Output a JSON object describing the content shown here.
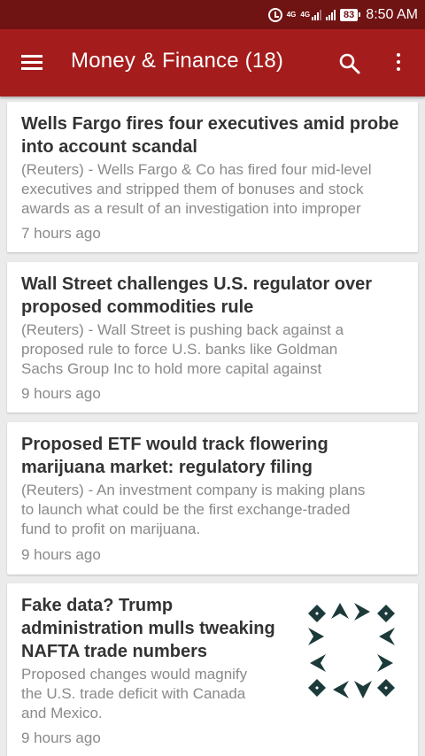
{
  "status_bar": {
    "network_label": "4G",
    "network_label_2": "4G",
    "battery": "83",
    "time": "8:50 AM"
  },
  "app_bar": {
    "title": "Money & Finance (18)",
    "menu_icon": "hamburger-menu-icon",
    "search_icon": "search-icon",
    "more_icon": "overflow-menu-icon",
    "color": "#a51c1c",
    "status_color": "#6f1313"
  },
  "articles": [
    {
      "title_lines": [
        "Wells Fargo fires four executives amid probe",
        "into account scandal"
      ],
      "summary_lines": [
        "(Reuters) - Wells Fargo & Co has fired four mid-level",
        "executives and stripped them of bonuses and stock",
        "awards as a result of an investigation into improper"
      ],
      "time": "7 hours ago"
    },
    {
      "title_lines": [
        "Wall Street challenges U.S. regulator over",
        "proposed commodities rule"
      ],
      "summary_lines": [
        "(Reuters) - Wall Street is pushing back against a",
        "proposed rule to force U.S. banks like Goldman",
        "Sachs Group Inc to hold more capital against"
      ],
      "time": "9 hours ago"
    },
    {
      "title_lines": [
        "Proposed ETF would track flowering",
        "marijuana market: regulatory filing"
      ],
      "summary_lines": [
        "(Reuters) - An investment company is making plans",
        "to launch what could be the first exchange-traded",
        "fund to profit on marijuana."
      ],
      "time": "9 hours ago"
    },
    {
      "title_lines": [
        "Fake data? Trump",
        "administration mulls tweaking",
        "NAFTA trade numbers"
      ],
      "summary_lines": [
        "Proposed changes would magnify",
        "the U.S. trade deficit with Canada",
        "and Mexico."
      ],
      "time": "9 hours ago",
      "thumbnail_icon": "nafta-logo-icon",
      "thumbnail_color": "#1c3a3a"
    }
  ]
}
